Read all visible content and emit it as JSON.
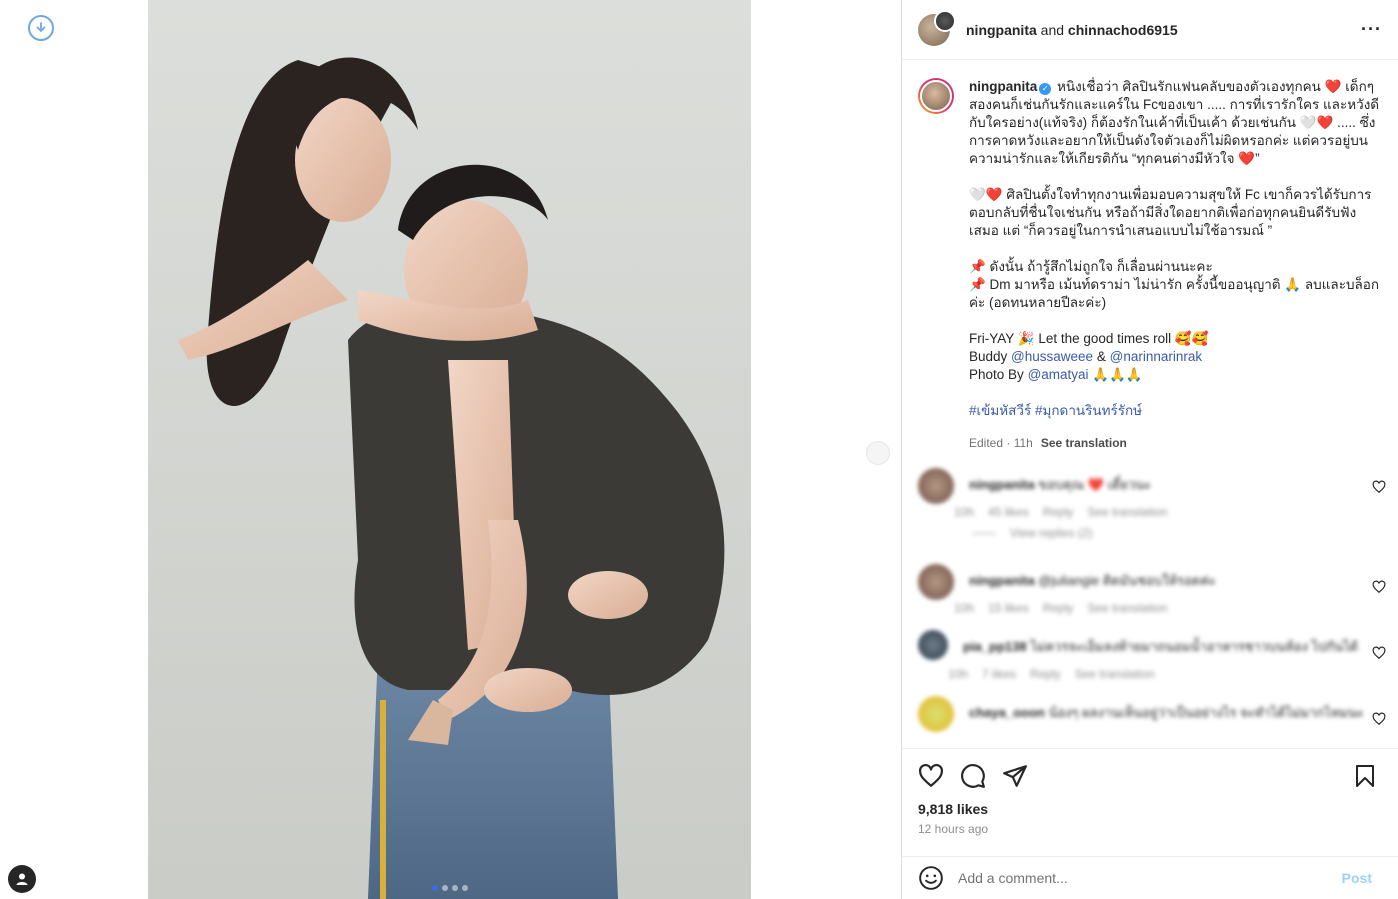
{
  "left_rail": {
    "download_icon": "download-circle-icon",
    "profile_icon": "profile-icon"
  },
  "photo": {
    "slides": 4,
    "active_slide": 1,
    "alt_description_icon": "post-photo"
  },
  "header": {
    "user1": "ningpanita",
    "connector": "and",
    "user2": "chinnachod6915",
    "more": "···"
  },
  "caption": {
    "username": "ningpanita",
    "p1": "หนิงเชื่อว่า ศิลปินรักแฟนคลับของตัวเองทุกคน ❤️ เด็กๆ สองคนก็เช่นกันรักและแคร์ใน Fcของเขา ..... การที่เรารักใคร และหวังดีกับใครอย่าง(แท้จริง) ก็ต้องรักในเค้าที่เป็นเค้า ด้วยเช่นกัน 🤍❤️ ..... ซึ่งการคาดหวังและอยากให้เป็นดังใจตัวเองก็ไม่ผิดหรอกค่ะ แต่ควรอยู่บนความน่ารักและให้เกียรติกัน “ทุกคนต่างมีหัวใจ ❤️”",
    "p2": "🤍❤️ ศิลปินตั้งใจทำทุกงานเพื่อมอบความสุขให้ Fc เขาก็ควรได้รับการตอบกลับที่ชื่นใจเช่นกัน หรือถ้ามีสิ่งใดอยากติเพื่อก่อทุกคนยินดีรับฟังเสมอ แต่ “ก็ควรอยู่ในการนำเสนอแบบไม่ใช้อารมณ์ ”",
    "p3a": "📌 ดังนั้น ถ้ารู้สึกไม่ถูกใจ ก็เลื่อนผ่านนะคะ",
    "p3b": "📌 Dm มาหรือ เม้นท์ดราม่า ไม่น่ารัก ครั้งนี้ขออนุญาติ 🙏 ลบและบล็อกค่ะ (อดทนหลายปีละค่ะ)",
    "p4a": "Fri-YAY 🎉 Let the good times roll 🥰🥰",
    "p4b_prefix": "Buddy",
    "p4b_link1": "@hussaweee",
    "p4b_amp": "&",
    "p4b_link2": "@narinnarinrak",
    "p4c_prefix": "Photo By",
    "p4c_link": "@amatyai",
    "p4c_suffix": "🙏🙏🙏",
    "hashtags": "#เข้มหัสวีร์ #มุกดานรินทร์รักษ์",
    "edited": "Edited · 11h",
    "see_translation": "See translation"
  },
  "comments": [
    {
      "user": "ningpanita",
      "text": "ขอบคุณ ❤️ เดี๋ยวนะ",
      "time": "10h",
      "likes": "45 likes",
      "reply": "Reply",
      "translate": "See translation",
      "avatar": "pink"
    },
    {
      "view_replies": "View replies (2)"
    },
    {
      "user": "ningpanita",
      "text": "@juliangie ติดมันชอบให้รอดค่ะ",
      "time": "10h",
      "likes": "15 likes",
      "reply": "Reply",
      "translate": "See translation",
      "avatar": "pink"
    },
    {
      "user": "pia_pp138",
      "text": "ไม่ควรจะเอ็มลงท้ายมาถนอมน้ำอาหารชาวบนห้อง ไปกันได้",
      "time": "10h",
      "likes": "7 likes",
      "reply": "Reply",
      "translate": "See translation",
      "avatar": "grey"
    },
    {
      "user": "chaya_ooon",
      "text": "น้องๆ ผลงานเห็นอยู่ว่าเป็นอย่างไร จะทำได้ไม่มากไหมนะ",
      "time": "",
      "likes": "",
      "reply": "",
      "translate": "",
      "avatar": "yellow"
    }
  ],
  "actions": {
    "likes": "9,818 likes",
    "time": "12 hours ago"
  },
  "add_comment": {
    "placeholder": "Add a comment...",
    "post": "Post"
  },
  "colors": {
    "link": "#3b5aa8",
    "post_button": "#9ed0f7",
    "verified": "#3897f0",
    "heart": "#e0241a"
  }
}
